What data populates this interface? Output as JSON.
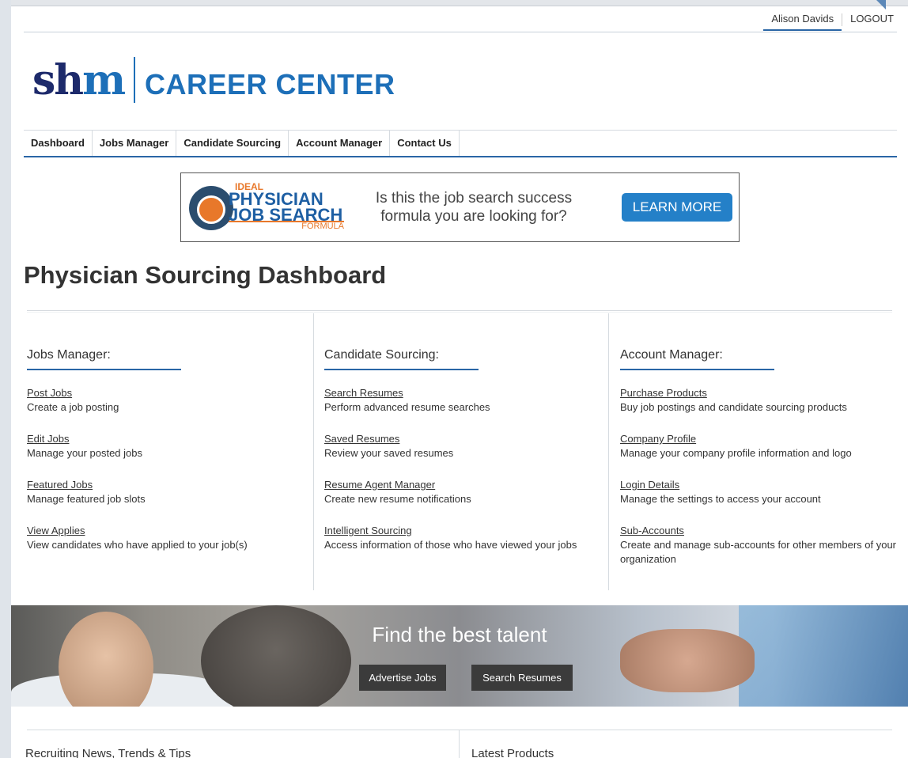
{
  "user_bar": {
    "user_name": "Alison Davids",
    "logout": "LOGOUT"
  },
  "logo": {
    "shm_s": "sh",
    "shm_m": "m",
    "career_center": "CAREER CENTER"
  },
  "nav": [
    {
      "label": "Dashboard"
    },
    {
      "label": "Jobs Manager"
    },
    {
      "label": "Candidate Sourcing"
    },
    {
      "label": "Account Manager"
    },
    {
      "label": "Contact Us"
    }
  ],
  "ad": {
    "ideal": "IDEAL",
    "line1": "PHYSICIAN",
    "line2": "JOB SEARCH",
    "formula": "FORMULA",
    "copy": "Is this the job search success formula you are looking for?",
    "button": "LEARN MORE",
    "colors": {
      "blue": "#1e5fa3",
      "orange": "#e8782a",
      "button": "#2480c8"
    }
  },
  "page_title": "Physician Sourcing Dashboard",
  "columns": [
    {
      "heading": "Jobs Manager:",
      "items": [
        {
          "link": "Post Jobs",
          "desc": "Create a job posting"
        },
        {
          "link": "Edit Jobs",
          "desc": "Manage your posted jobs"
        },
        {
          "link": "Featured Jobs",
          "desc": "Manage featured job slots"
        },
        {
          "link": "View Applies",
          "desc": "View candidates who have applied to your job(s)"
        }
      ]
    },
    {
      "heading": "Candidate Sourcing:",
      "items": [
        {
          "link": "Search Resumes",
          "desc": "Perform advanced resume searches"
        },
        {
          "link": "Saved Resumes",
          "desc": "Review your saved resumes"
        },
        {
          "link": "Resume Agent Manager",
          "desc": "Create new resume notifications"
        },
        {
          "link": "Intelligent Sourcing",
          "desc": "Access information of those who have viewed your jobs"
        }
      ]
    },
    {
      "heading": "Account Manager:",
      "items": [
        {
          "link": "Purchase Products",
          "desc": "Buy job postings and candidate sourcing products"
        },
        {
          "link": "Company Profile",
          "desc": "Manage your company profile information and logo"
        },
        {
          "link": "Login Details",
          "desc": "Manage the settings to access your account"
        },
        {
          "link": "Sub-Accounts",
          "desc": "Create and manage sub-accounts for other members of your organization"
        }
      ]
    }
  ],
  "hero": {
    "title": "Find the best talent",
    "advertise_button": "Advertise Jobs",
    "search_button": "Search Resumes"
  },
  "bottom": {
    "left_heading": "Recruiting News, Trends & Tips",
    "right_heading": "Latest Products"
  },
  "colors": {
    "accent": "#2a66a6",
    "brand_navy": "#1d2a6b",
    "brand_blue": "#1d6fb8"
  }
}
